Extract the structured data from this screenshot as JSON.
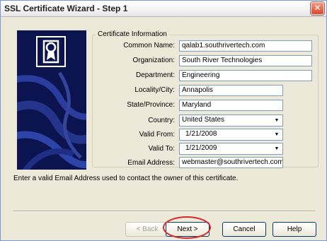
{
  "window": {
    "title": "SSL Certificate Wizard - Step 1",
    "close_glyph": "✕"
  },
  "group": {
    "label": "Certificate Information"
  },
  "fields": {
    "common_name": {
      "label": "Common Name:",
      "value": "qalab1.southrivertech.com"
    },
    "organization": {
      "label": "Organization:",
      "value": "South River Technologies"
    },
    "department": {
      "label": "Department:",
      "value": "Engineering"
    },
    "locality": {
      "label": "Locality/City:",
      "value": "Annapolis"
    },
    "state": {
      "label": "State/Province:",
      "value": "Maryland"
    },
    "country": {
      "label": "Country:",
      "value": "United States"
    },
    "valid_from": {
      "label": "Valid From:",
      "value": "1/21/2008"
    },
    "valid_to": {
      "label": "Valid To:",
      "value": "1/21/2009"
    },
    "email": {
      "label": "Email Address:",
      "value": "webmaster@southrivertech.com"
    }
  },
  "message": "Enter a valid Email Address used to contact the owner of this certificate.",
  "buttons": {
    "back": "< Back",
    "next": "Next >",
    "cancel": "Cancel",
    "help": "Help"
  },
  "icons": {
    "certificate": "certificate-icon",
    "close": "close-icon",
    "dropdown": "chevron-down-icon"
  },
  "colors": {
    "highlight": "#d42a2a",
    "panel": "#0c1450"
  }
}
